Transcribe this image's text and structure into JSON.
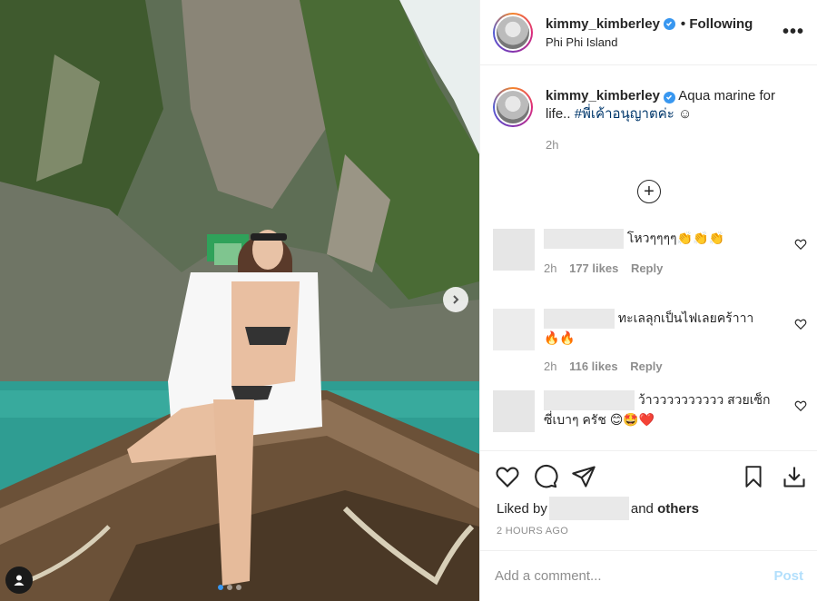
{
  "post": {
    "username": "kimmy_kimberley",
    "following_label": "• Following",
    "location": "Phi Phi Island",
    "more_label": "•••"
  },
  "caption": {
    "username": "kimmy_kimberley",
    "text": " Aqua marine for life.. ",
    "hashtag": "#พี่เค้าอนุญาตค่ะ",
    "emoji": " ☺",
    "time": "2h"
  },
  "load_more_label": "+",
  "comments": [
    {
      "text": "โหวๆๆๆๆ👏👏👏",
      "time": "2h",
      "likes": "177 likes",
      "reply": "Reply"
    },
    {
      "text": " ทะเลลุกเป็นไฟเลยคร้าาา 🔥🔥",
      "time": "2h",
      "likes": "116 likes",
      "reply": "Reply"
    },
    {
      "text": " ว้าวววววววววว สวยเซ็กซี่เบาๆ ครัช 😊🤩❤️"
    }
  ],
  "likes": {
    "prefix": "Liked by",
    "suffix": "and",
    "others": "others"
  },
  "time_ago": "2 HOURS AGO",
  "comment_input": {
    "placeholder": "Add a comment...",
    "post_label": "Post"
  },
  "colors": {
    "accent": "#3897f0",
    "post_disabled": "#b2dffc",
    "muted": "#8e8e8e"
  }
}
